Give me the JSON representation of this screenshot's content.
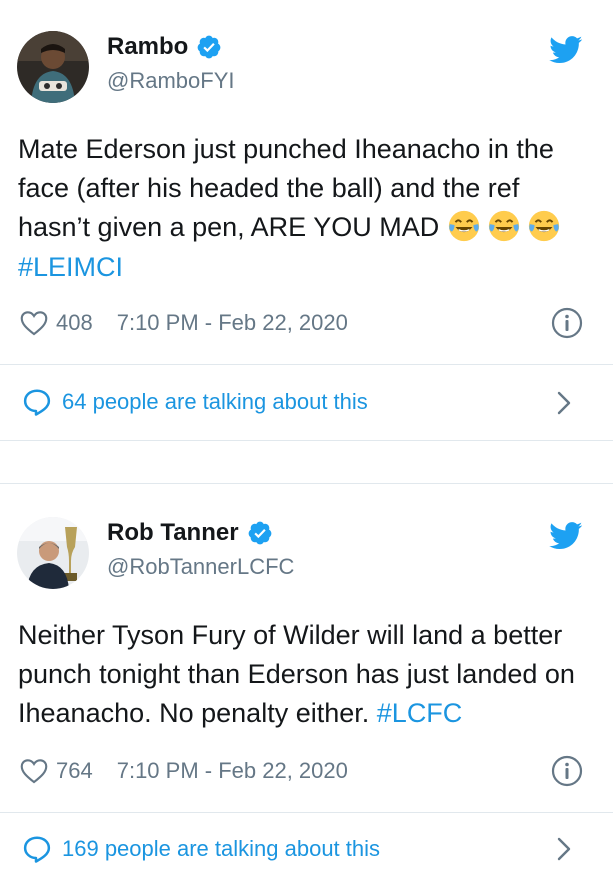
{
  "tweets": [
    {
      "name": "Rambo",
      "handle": "@RamboFYI",
      "text": "Mate Ederson just punched Iheanacho in the face (after his headed the ball) and the ref hasn’t given a pen, ARE YOU MAD",
      "emoji": [
        "face-with-tears-of-joy",
        "face-with-tears-of-joy",
        "face-with-tears-of-joy"
      ],
      "hashtag": "#LEIMCI",
      "likes": "408",
      "timestamp": "7:10 PM - Feb 22, 2020",
      "talking": "64 people are talking about this"
    },
    {
      "name": "Rob Tanner",
      "handle": "@RobTannerLCFC",
      "text": "Neither Tyson Fury of Wilder will land a better punch tonight than Ederson has just landed on Iheanacho. No penalty either.",
      "hashtag": "#LCFC",
      "likes": "764",
      "timestamp": "7:10 PM - Feb 22, 2020",
      "talking": "169 people are talking about this"
    }
  ],
  "colors": {
    "link": "#1b95e0",
    "twitter_blue": "#1da1f2",
    "secondary_text": "#657786",
    "divider": "#e1e8ed"
  },
  "icons": [
    "verified-badge-icon",
    "twitter-bird-icon",
    "heart-icon",
    "info-icon",
    "speech-bubble-icon",
    "chevron-right-icon"
  ]
}
